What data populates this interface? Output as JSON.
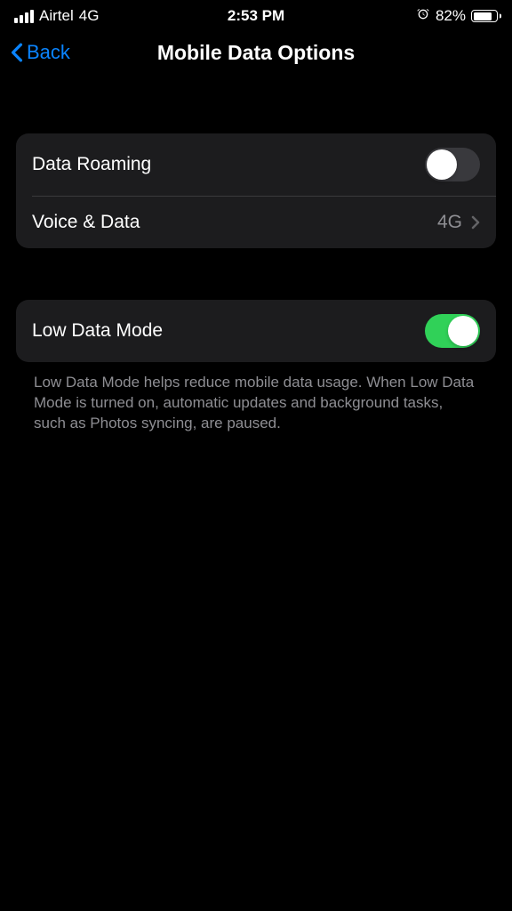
{
  "statusBar": {
    "carrier": "Airtel",
    "networkType": "4G",
    "time": "2:53 PM",
    "batteryPercent": "82%"
  },
  "nav": {
    "back": "Back",
    "title": "Mobile Data Options"
  },
  "group1": {
    "dataRoaming": {
      "label": "Data Roaming",
      "enabled": false
    },
    "voiceData": {
      "label": "Voice & Data",
      "value": "4G"
    }
  },
  "group2": {
    "lowDataMode": {
      "label": "Low Data Mode",
      "enabled": true
    },
    "footer": "Low Data Mode helps reduce mobile data usage. When Low Data Mode is turned on, automatic updates and background tasks, such as Photos syncing, are paused."
  }
}
